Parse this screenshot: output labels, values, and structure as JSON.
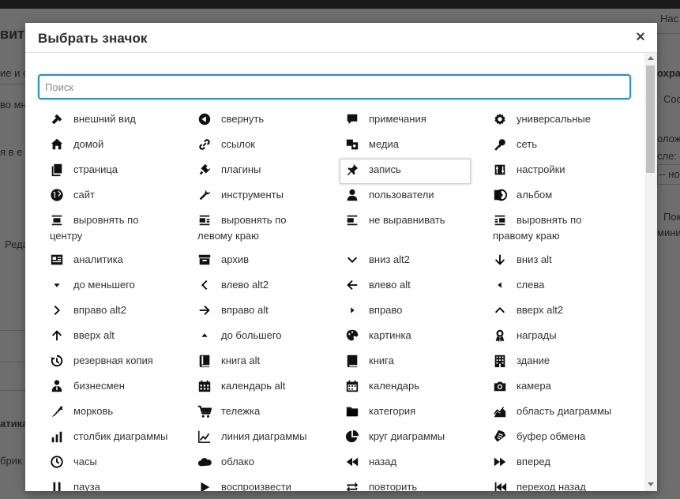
{
  "background": {
    "left": [
      "вит",
      "ие и с",
      "во мн",
      "я в е",
      "Реда",
      "атика",
      "брик"
    ],
    "right": [
      "Нас",
      "охра",
      "Сос",
      "олож",
      "сле:",
      "-- но",
      "Пок",
      "мини"
    ]
  },
  "modal": {
    "title": "Выбрать значок",
    "close": "×",
    "search_placeholder": "Поиск",
    "icons": [
      {
        "label": "внешний вид",
        "icon": "paint-roller-icon"
      },
      {
        "label": "свернуть",
        "icon": "collapse-icon"
      },
      {
        "label": "примечания",
        "icon": "comment-icon"
      },
      {
        "label": "универсальные",
        "icon": "gear-icon"
      },
      {
        "label": "домой",
        "icon": "home-icon"
      },
      {
        "label": "ссылок",
        "icon": "link-icon"
      },
      {
        "label": "медиа",
        "icon": "media-icon"
      },
      {
        "label": "сеть",
        "icon": "key-icon"
      },
      {
        "label": "страница",
        "icon": "page-icon"
      },
      {
        "label": "плагины",
        "icon": "plugin-icon"
      },
      {
        "label": "запись",
        "icon": "pin-icon",
        "selected": true
      },
      {
        "label": "настройки",
        "icon": "settings-icon"
      },
      {
        "label": "сайт",
        "icon": "globe-icon"
      },
      {
        "label": "инструменты",
        "icon": "wrench-icon"
      },
      {
        "label": "пользователи",
        "icon": "user-icon"
      },
      {
        "label": "альбом",
        "icon": "album-icon"
      },
      {
        "label": "выровнять по центру",
        "icon": "align-center-icon",
        "tall": true
      },
      {
        "label": "выровнять по левому краю",
        "icon": "align-left-icon",
        "tall": true
      },
      {
        "label": "не выравнивать",
        "icon": "align-none-icon",
        "tall": true
      },
      {
        "label": "выровнять по правому краю",
        "icon": "align-right-icon",
        "tall": true
      },
      {
        "label": "аналитика",
        "icon": "analytics-icon"
      },
      {
        "label": "архив",
        "icon": "archive-icon"
      },
      {
        "label": "вниз alt2",
        "icon": "chevron-down-icon"
      },
      {
        "label": "вниз alt",
        "icon": "arrow-down-icon"
      },
      {
        "label": "до меньшего",
        "icon": "triangle-down-icon"
      },
      {
        "label": "влево alt2",
        "icon": "chevron-left-icon"
      },
      {
        "label": "влево alt",
        "icon": "arrow-left-icon"
      },
      {
        "label": "слева",
        "icon": "triangle-left-icon"
      },
      {
        "label": "вправо alt2",
        "icon": "chevron-right-icon"
      },
      {
        "label": "вправо alt",
        "icon": "arrow-right-icon"
      },
      {
        "label": "вправо",
        "icon": "triangle-right-icon"
      },
      {
        "label": "вверх alt2",
        "icon": "chevron-up-icon"
      },
      {
        "label": "вверх alt",
        "icon": "arrow-up-icon"
      },
      {
        "label": "до большего",
        "icon": "triangle-up-icon"
      },
      {
        "label": "картинка",
        "icon": "palette-icon"
      },
      {
        "label": "награды",
        "icon": "award-icon"
      },
      {
        "label": "резервная копия",
        "icon": "backup-icon"
      },
      {
        "label": "книга alt",
        "icon": "book-alt-icon"
      },
      {
        "label": "книга",
        "icon": "book-icon"
      },
      {
        "label": "здание",
        "icon": "building-icon"
      },
      {
        "label": "бизнесмен",
        "icon": "businessman-icon"
      },
      {
        "label": "календарь alt",
        "icon": "calendar-alt-icon"
      },
      {
        "label": "календарь",
        "icon": "calendar-icon"
      },
      {
        "label": "камера",
        "icon": "camera-icon"
      },
      {
        "label": "морковь",
        "icon": "carrot-icon"
      },
      {
        "label": "тележка",
        "icon": "cart-icon"
      },
      {
        "label": "категория",
        "icon": "folder-icon"
      },
      {
        "label": "область диаграммы",
        "icon": "chart-area-icon"
      },
      {
        "label": "столбик диаграммы",
        "icon": "chart-bar-icon"
      },
      {
        "label": "линия диаграммы",
        "icon": "chart-line-icon"
      },
      {
        "label": "круг диаграммы",
        "icon": "chart-pie-icon"
      },
      {
        "label": "буфер обмена",
        "icon": "clipboard-icon"
      },
      {
        "label": "часы",
        "icon": "clock-icon"
      },
      {
        "label": "облако",
        "icon": "cloud-icon"
      },
      {
        "label": "назад",
        "icon": "rewind-icon"
      },
      {
        "label": "вперед",
        "icon": "forward-icon"
      },
      {
        "label": "пауза",
        "icon": "pause-icon"
      },
      {
        "label": "воспроизвести",
        "icon": "play-icon"
      },
      {
        "label": "повторить",
        "icon": "repeat-icon"
      },
      {
        "label": "переход назад",
        "icon": "skip-back-icon"
      }
    ]
  }
}
